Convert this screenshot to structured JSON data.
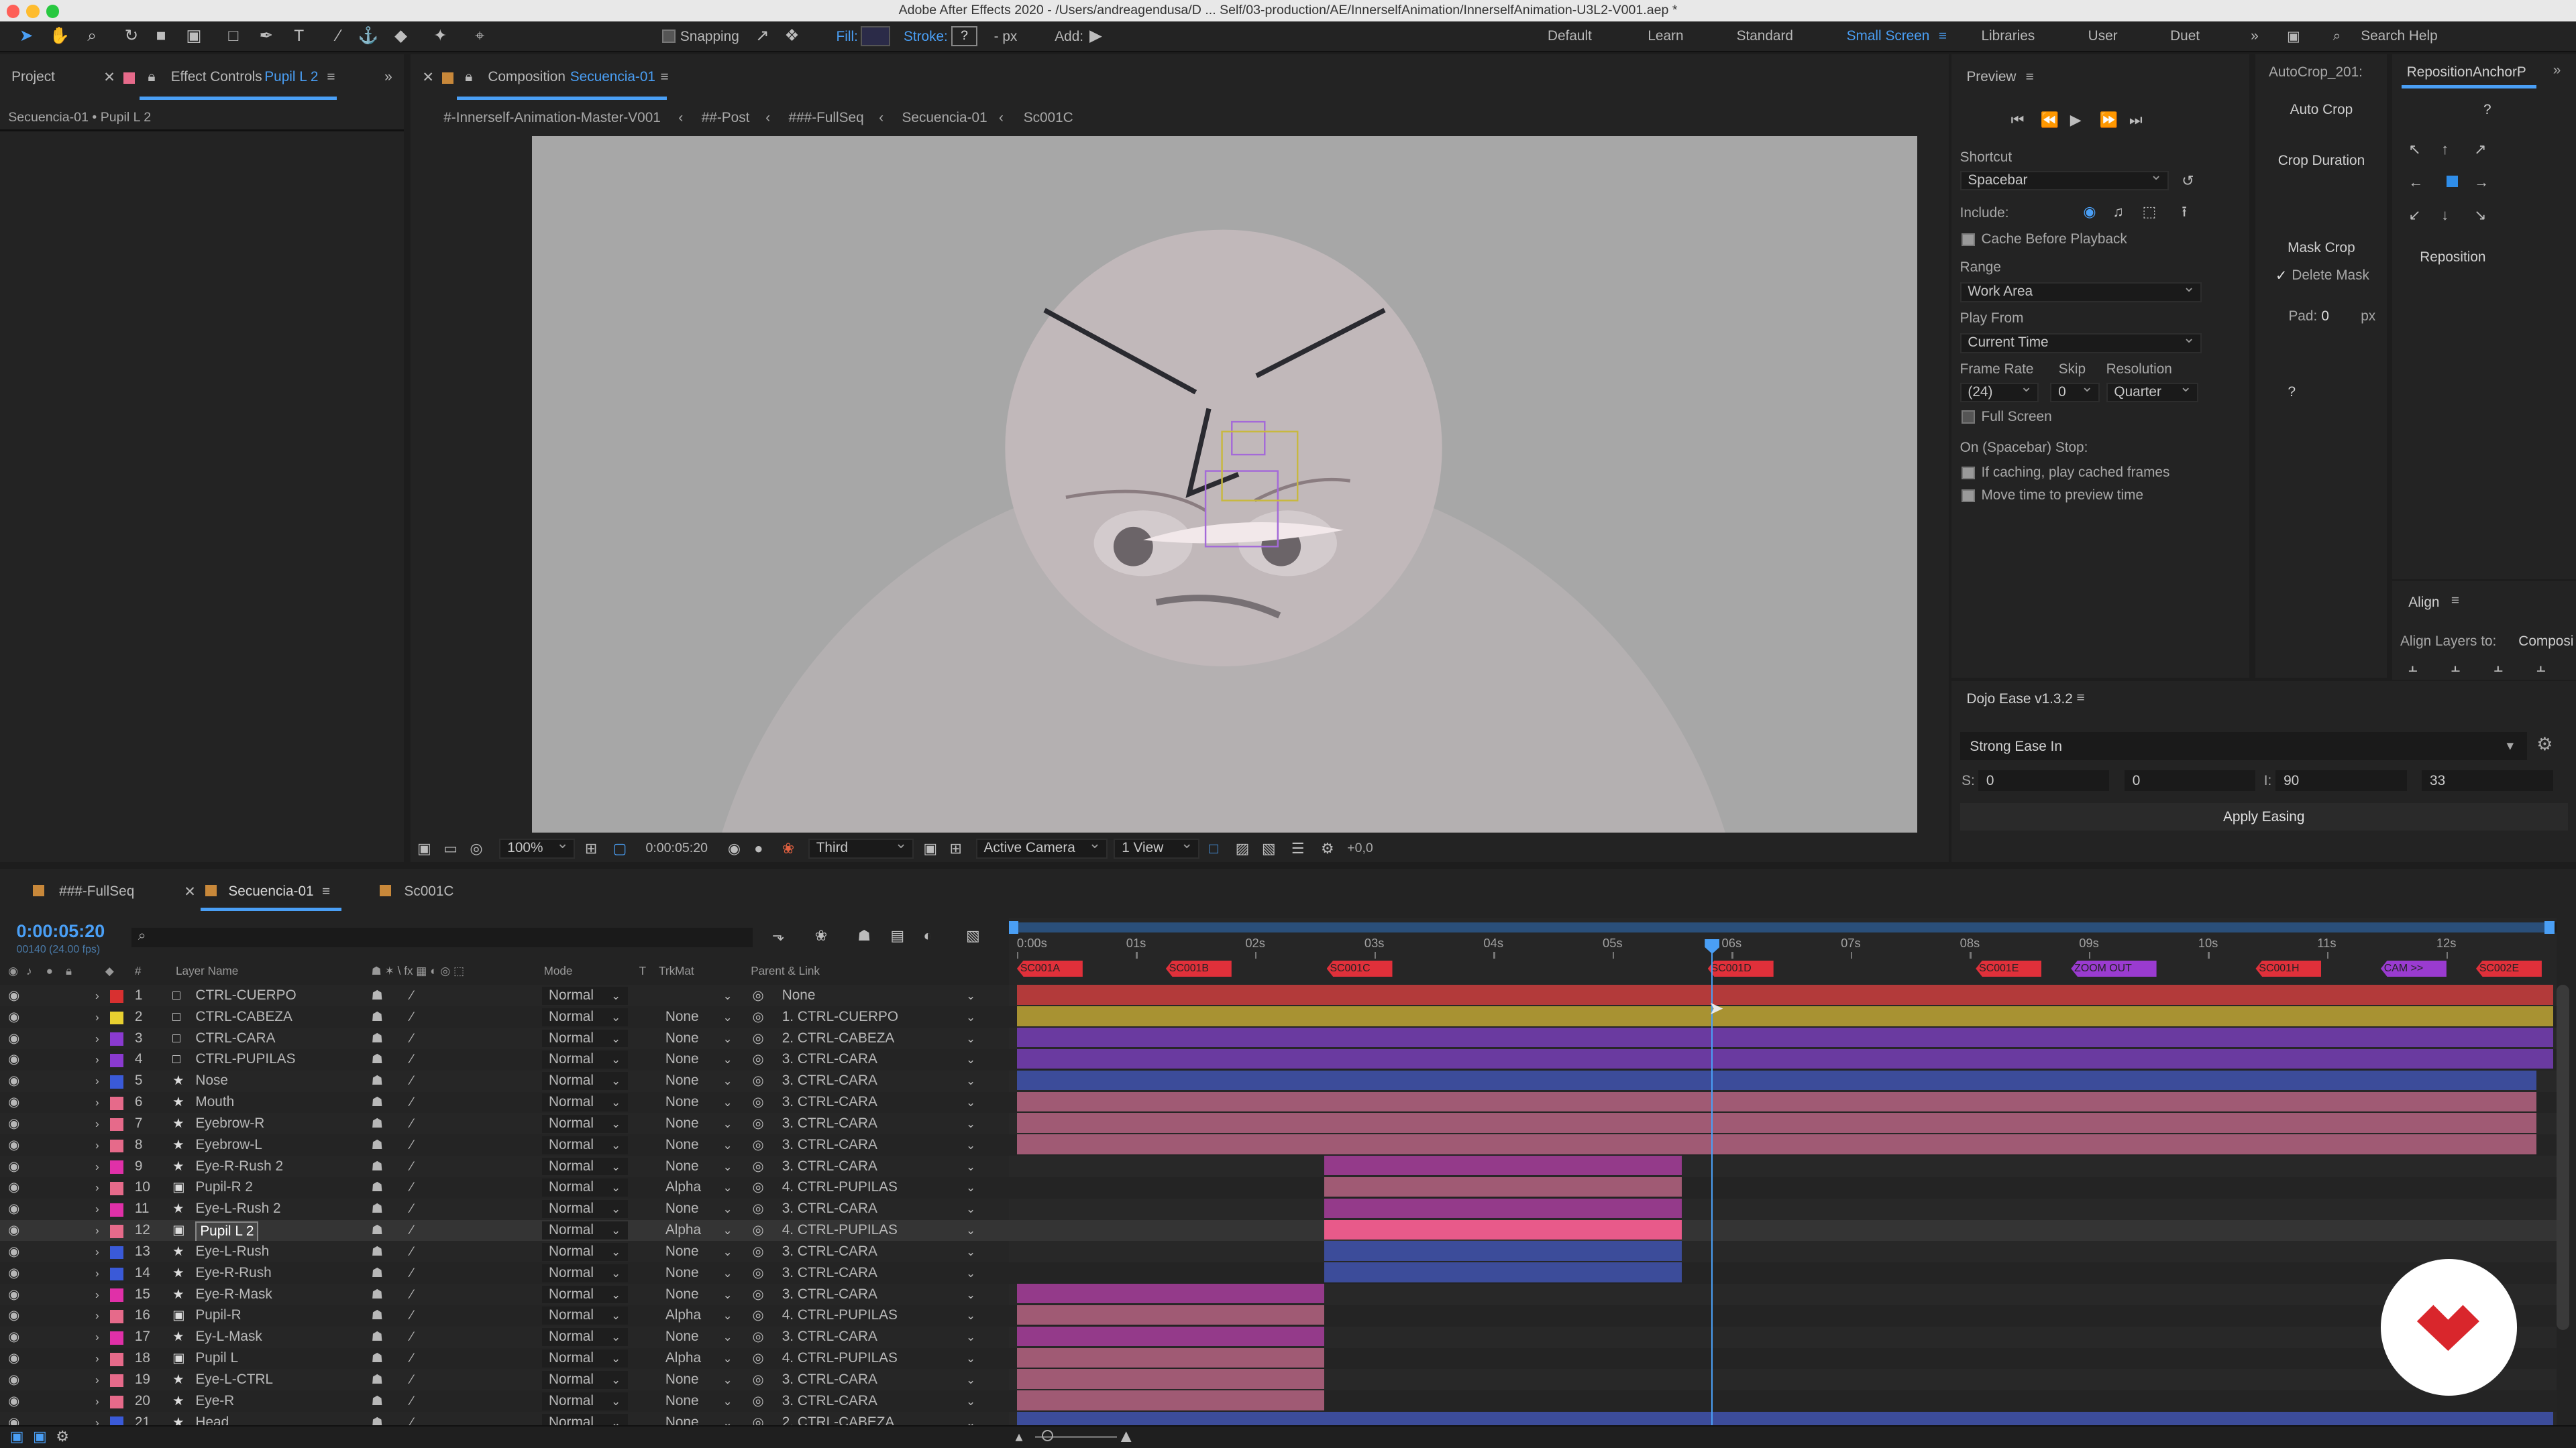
{
  "window_title": "Adobe After Effects 2020 - /Users/andreagendusa/D ... Self/03-production/AE/InnerselfAnimation/InnerselfAnimation-U3L2-V001.aep *",
  "toolbar": {
    "snapping": "Snapping",
    "fill": "Fill:",
    "stroke": "Stroke:",
    "stroke_value": "?",
    "px": "- px",
    "add": "Add:",
    "workspaces": [
      "Default",
      "Learn",
      "Standard",
      "Small Screen",
      "Libraries",
      "User",
      "Duet"
    ],
    "active_workspace": "Small Screen",
    "search_placeholder": "Search Help"
  },
  "left_panel": {
    "tab_project": "Project",
    "tab_effect_controls": "Effect Controls",
    "effect_target": "Pupil L 2",
    "breadcrumb": "Secuencia-01 • Pupil L 2"
  },
  "composition": {
    "tab_label": "Composition",
    "comp_name": "Secuencia-01",
    "breadcrumbs": [
      "#-Innerself-Animation-Master-V001",
      "##-Post",
      "###-FullSeq",
      "Secuencia-01",
      "Sc001C"
    ],
    "active_crumb": "Secuencia-01",
    "zoom": "100%",
    "timecode": "0:00:05:20",
    "resolution": "Third",
    "camera": "Active Camera",
    "views": "1 View",
    "exposure": "+0,0"
  },
  "preview": {
    "title": "Preview",
    "shortcut_label": "Shortcut",
    "shortcut": "Spacebar",
    "include_label": "Include:",
    "cache_before_playback": "Cache Before Playback",
    "range_label": "Range",
    "range": "Work Area",
    "play_from_label": "Play From",
    "play_from": "Current Time",
    "frame_rate_label": "Frame Rate",
    "skip_label": "Skip",
    "resolution_label": "Resolution",
    "frame_rate": "(24)",
    "skip": "0",
    "resolution": "Quarter",
    "full_screen": "Full Screen",
    "on_stop": "On (Spacebar) Stop:",
    "if_caching": "If caching, play cached frames",
    "move_time": "Move time to preview time"
  },
  "autocrop": {
    "title": "AutoCrop_201:",
    "auto_crop": "Auto Crop",
    "crop_duration": "Crop Duration",
    "mask_crop": "Mask Crop",
    "delete_mask": "Delete Mask",
    "pad_label": "Pad:",
    "pad_value": "0",
    "pad_unit": "px",
    "help": "?"
  },
  "reposition": {
    "title": "RepositionAnchorP",
    "help": "?",
    "button": "Reposition"
  },
  "align": {
    "title": "Align",
    "align_to_label": "Align Layers to:",
    "align_to": "Composi"
  },
  "dojo": {
    "title": "Dojo Ease v1.3.2",
    "preset": "Strong Ease In",
    "s_label": "S:",
    "s1": "0",
    "s2": "0",
    "i_label": "I:",
    "i1": "90",
    "i2": "33",
    "apply": "Apply Easing"
  },
  "timeline": {
    "tabs": [
      "###-FullSeq",
      "Secuencia-01",
      "Sc001C"
    ],
    "active_tab": "Secuencia-01",
    "timecode": "0:00:05:20",
    "frame_info": "00140 (24.00 fps)",
    "col_layer_name": "Layer Name",
    "col_mode": "Mode",
    "col_t": "T",
    "col_trkmat": "TrkMat",
    "col_parent": "Parent & Link",
    "ruler": [
      "0:00s",
      "01s",
      "02s",
      "03s",
      "04s",
      "05s",
      "06s",
      "07s",
      "08s",
      "09s",
      "10s",
      "11s",
      "12s"
    ],
    "current_time_s": 5.83,
    "duration_s": 12.92,
    "markers": [
      {
        "label": "SC001A",
        "t": 0.0,
        "color": "#e0303a"
      },
      {
        "label": "SC001B",
        "t": 1.25,
        "color": "#e0303a"
      },
      {
        "label": "SC001C",
        "t": 2.6,
        "color": "#e0303a"
      },
      {
        "label": "SC001D",
        "t": 5.8,
        "color": "#e0303a"
      },
      {
        "label": "SC001E",
        "t": 8.05,
        "color": "#e0303a"
      },
      {
        "label": "ZOOM OUT",
        "t": 8.85,
        "color": "#9a3bd0"
      },
      {
        "label": "SC001H",
        "t": 10.4,
        "color": "#e0303a"
      },
      {
        "label": "CAM >>",
        "t": 11.45,
        "color": "#9a3bd0"
      },
      {
        "label": "SC002E",
        "t": 12.25,
        "color": "#e0303a"
      }
    ],
    "layers": [
      {
        "num": "1",
        "name": "CTRL-CUERPO",
        "type": "null",
        "label_color": "#d83030",
        "mode": "Normal",
        "trkmat": "",
        "parent": "None",
        "start": 0.0,
        "end": 12.9,
        "bar_color": "#b33a3a"
      },
      {
        "num": "2",
        "name": "CTRL-CABEZA",
        "type": "null",
        "label_color": "#e8d030",
        "mode": "Normal",
        "trkmat": "None",
        "parent": "1. CTRL-CUERPO",
        "start": 0.0,
        "end": 12.9,
        "bar_color": "#a89232"
      },
      {
        "num": "3",
        "name": "CTRL-CARA",
        "type": "null",
        "label_color": "#8a3ad0",
        "mode": "Normal",
        "trkmat": "None",
        "parent": "2. CTRL-CABEZA",
        "start": 0.0,
        "end": 12.9,
        "bar_color": "#6a3aa0"
      },
      {
        "num": "4",
        "name": "CTRL-PUPILAS",
        "type": "null",
        "label_color": "#8a3ad0",
        "mode": "Normal",
        "trkmat": "None",
        "parent": "3. CTRL-CARA",
        "start": 0.0,
        "end": 12.9,
        "bar_color": "#6a3aa0"
      },
      {
        "num": "5",
        "name": "Nose",
        "type": "shape",
        "label_color": "#3a5ad8",
        "mode": "Normal",
        "trkmat": "None",
        "parent": "3. CTRL-CARA",
        "start": 0.0,
        "end": 12.76,
        "bar_color": "#3c4c9a"
      },
      {
        "num": "6",
        "name": "Mouth",
        "type": "shape",
        "label_color": "#e66a8a",
        "mode": "Normal",
        "trkmat": "None",
        "parent": "3. CTRL-CARA",
        "start": 0.0,
        "end": 12.76,
        "bar_color": "#a05a74"
      },
      {
        "num": "7",
        "name": "Eyebrow-R",
        "type": "shape",
        "label_color": "#e66a8a",
        "mode": "Normal",
        "trkmat": "None",
        "parent": "3. CTRL-CARA",
        "start": 0.0,
        "end": 12.76,
        "bar_color": "#a05a74"
      },
      {
        "num": "8",
        "name": "Eyebrow-L",
        "type": "shape",
        "label_color": "#e66a8a",
        "mode": "Normal",
        "trkmat": "None",
        "parent": "3. CTRL-CARA",
        "start": 0.0,
        "end": 12.76,
        "bar_color": "#a05a74"
      },
      {
        "num": "9",
        "name": "Eye-R-Rush 2",
        "type": "shape",
        "label_color": "#e030a8",
        "mode": "Normal",
        "trkmat": "None",
        "parent": "3. CTRL-CARA",
        "start": 2.58,
        "end": 5.58,
        "bar_color": "#943a8a"
      },
      {
        "num": "10",
        "name": "Pupil-R 2",
        "type": "precomp",
        "label_color": "#e66a8a",
        "mode": "Normal",
        "trkmat": "Alpha",
        "parent": "4. CTRL-PUPILAS",
        "start": 2.58,
        "end": 5.58,
        "bar_color": "#a05a74"
      },
      {
        "num": "11",
        "name": "Eye-L-Rush 2",
        "type": "shape",
        "label_color": "#e030a8",
        "mode": "Normal",
        "trkmat": "None",
        "parent": "3. CTRL-CARA",
        "start": 2.58,
        "end": 5.58,
        "bar_color": "#943a8a"
      },
      {
        "num": "12",
        "name": "Pupil L 2",
        "type": "precomp",
        "label_color": "#e66a8a",
        "mode": "Normal",
        "trkmat": "Alpha",
        "parent": "4. CTRL-PUPILAS",
        "start": 2.58,
        "end": 5.58,
        "bar_color": "#e85a8a",
        "selected": true
      },
      {
        "num": "13",
        "name": "Eye-L-Rush",
        "type": "shape",
        "label_color": "#3a5ad8",
        "mode": "Normal",
        "trkmat": "None",
        "parent": "3. CTRL-CARA",
        "start": 2.58,
        "end": 5.58,
        "bar_color": "#3c4c9a"
      },
      {
        "num": "14",
        "name": "Eye-R-Rush",
        "type": "shape",
        "label_color": "#3a5ad8",
        "mode": "Normal",
        "trkmat": "None",
        "parent": "3. CTRL-CARA",
        "start": 2.58,
        "end": 5.58,
        "bar_color": "#3c4c9a"
      },
      {
        "num": "15",
        "name": "Eye-R-Mask",
        "type": "shape",
        "label_color": "#e030a8",
        "mode": "Normal",
        "trkmat": "None",
        "parent": "3. CTRL-CARA",
        "start": 0.0,
        "end": 2.58,
        "bar_color": "#943a8a"
      },
      {
        "num": "16",
        "name": "Pupil-R",
        "type": "precomp",
        "label_color": "#e66a8a",
        "mode": "Normal",
        "trkmat": "Alpha",
        "parent": "4. CTRL-PUPILAS",
        "start": 0.0,
        "end": 2.58,
        "bar_color": "#a05a74"
      },
      {
        "num": "17",
        "name": "Ey-L-Mask",
        "type": "shape",
        "label_color": "#e030a8",
        "mode": "Normal",
        "trkmat": "None",
        "parent": "3. CTRL-CARA",
        "start": 0.0,
        "end": 2.58,
        "bar_color": "#943a8a"
      },
      {
        "num": "18",
        "name": "Pupil L",
        "type": "precomp",
        "label_color": "#e66a8a",
        "mode": "Normal",
        "trkmat": "Alpha",
        "parent": "4. CTRL-PUPILAS",
        "start": 0.0,
        "end": 2.58,
        "bar_color": "#a05a74"
      },
      {
        "num": "19",
        "name": "Eye-L-CTRL",
        "type": "shape",
        "label_color": "#e66a8a",
        "mode": "Normal",
        "trkmat": "None",
        "parent": "3. CTRL-CARA",
        "start": 0.0,
        "end": 2.58,
        "bar_color": "#a05a74"
      },
      {
        "num": "20",
        "name": "Eye-R",
        "type": "shape",
        "label_color": "#e66a8a",
        "mode": "Normal",
        "trkmat": "None",
        "parent": "3. CTRL-CARA",
        "start": 0.0,
        "end": 2.58,
        "bar_color": "#a05a74"
      },
      {
        "num": "21",
        "name": "Head",
        "type": "shape",
        "label_color": "#3a5ad8",
        "mode": "Normal",
        "trkmat": "None",
        "parent": "2. CTRL-CABEZA",
        "start": 0.0,
        "end": 12.9,
        "bar_color": "#3c4c9a"
      }
    ]
  },
  "colors": {
    "accent": "#4a9ff5",
    "panel_bg": "#232323",
    "viewer_bg": "#a7a7a7"
  }
}
